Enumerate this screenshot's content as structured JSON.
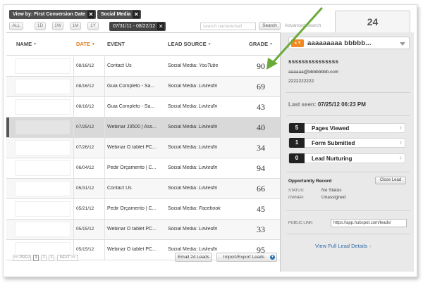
{
  "filters": {
    "view_by": "View by: First Conversion Date",
    "source": "Social Media",
    "range_all": "ALL",
    "range_1d": "1D",
    "range_1w": "1W",
    "range_1m": "1M",
    "range_1y": "1Y",
    "date_range": "07/31/11 - 08/22/12",
    "search_placeholder": "search name/email",
    "search_button": "Search",
    "advanced_search": "Advanced Search",
    "lead_count": "24"
  },
  "table": {
    "columns": {
      "name": "NAME",
      "date": "DATE",
      "event": "EVENT",
      "lead_source": "LEAD SOURCE",
      "grade": "GRADE"
    },
    "rows": [
      {
        "date": "08/16/12",
        "event": "Contact Us",
        "source_prefix": "Social Media: ",
        "source_name": "YouTube",
        "grade": "90"
      },
      {
        "date": "08/16/12",
        "event": "Guia Completo - Sa...",
        "source_prefix": "Social Media: ",
        "source_name": "LinkedIn",
        "grade": "69"
      },
      {
        "date": "08/16/12",
        "event": "Guia Completo - Sa...",
        "source_prefix": "Social Media: ",
        "source_name": "LinkedIn",
        "grade": "43"
      },
      {
        "date": "07/25/12",
        "event": "Webinar J3500 | Ass...",
        "source_prefix": "Social Media: ",
        "source_name": "LinkedIn",
        "grade": "40"
      },
      {
        "date": "07/26/12",
        "event": "Webinar O tablet PC...",
        "source_prefix": "Social Media: ",
        "source_name": "LinkedIn",
        "grade": "34"
      },
      {
        "date": "06/04/12",
        "event": "Pedir Orçamento | C...",
        "source_prefix": "Social Media: ",
        "source_name": "LinkedIn",
        "grade": "94"
      },
      {
        "date": "05/31/12",
        "event": "Contact Us",
        "source_prefix": "Social Media: ",
        "source_name": "LinkedIn",
        "grade": "66"
      },
      {
        "date": "05/21/12",
        "event": "Pedir Orçamento | C...",
        "source_prefix": "Social Media: ",
        "source_name": "Facebook",
        "grade": "45"
      },
      {
        "date": "05/15/12",
        "event": "Webinar O tablet PC...",
        "source_prefix": "Social Media: ",
        "source_name": "LinkedIn",
        "grade": "33"
      },
      {
        "date": "05/15/12",
        "event": "Webinar O tablet PC...",
        "source_prefix": "Social Media: ",
        "source_name": "LinkedIn",
        "grade": "95"
      }
    ]
  },
  "pager": {
    "prev": "<< PREV",
    "p1": "1",
    "p2": "2",
    "p3": "3",
    "next": "NEXT >>"
  },
  "bottom": {
    "email_button": "Email 24 Leads",
    "import_export": "Import/Export Leads"
  },
  "panel": {
    "lead_name": "aaaaaaaaa bbbbb...",
    "full_name": "sssssssssssssss",
    "email": "aaaaaa@bbbbbbbb.com",
    "phone": "2222222222",
    "last_seen_label": "Last seen:",
    "last_seen_value": "07/25/12 06:23 PM",
    "activities": [
      {
        "count": "5",
        "label": "Pages Viewed"
      },
      {
        "count": "1",
        "label": "Form Submitted"
      },
      {
        "count": "0",
        "label": "Lead Nurturing"
      }
    ],
    "opportunity_title": "Opportunity Record",
    "close_lead": "Close Lead",
    "status_label": "STATUS:",
    "status_value": "No Status",
    "owner_label": "OWNER:",
    "owner_value": "Unassigned",
    "public_link_label": "PUBLIC LINK:",
    "public_link_value": "https://app.hubspot.com/leads/",
    "full_details": "View Full Lead Details"
  },
  "colors": {
    "accent_orange": "#e07b1c",
    "annotation_arrow": "#6aaa3a",
    "link_blue": "#2d6aa8"
  }
}
